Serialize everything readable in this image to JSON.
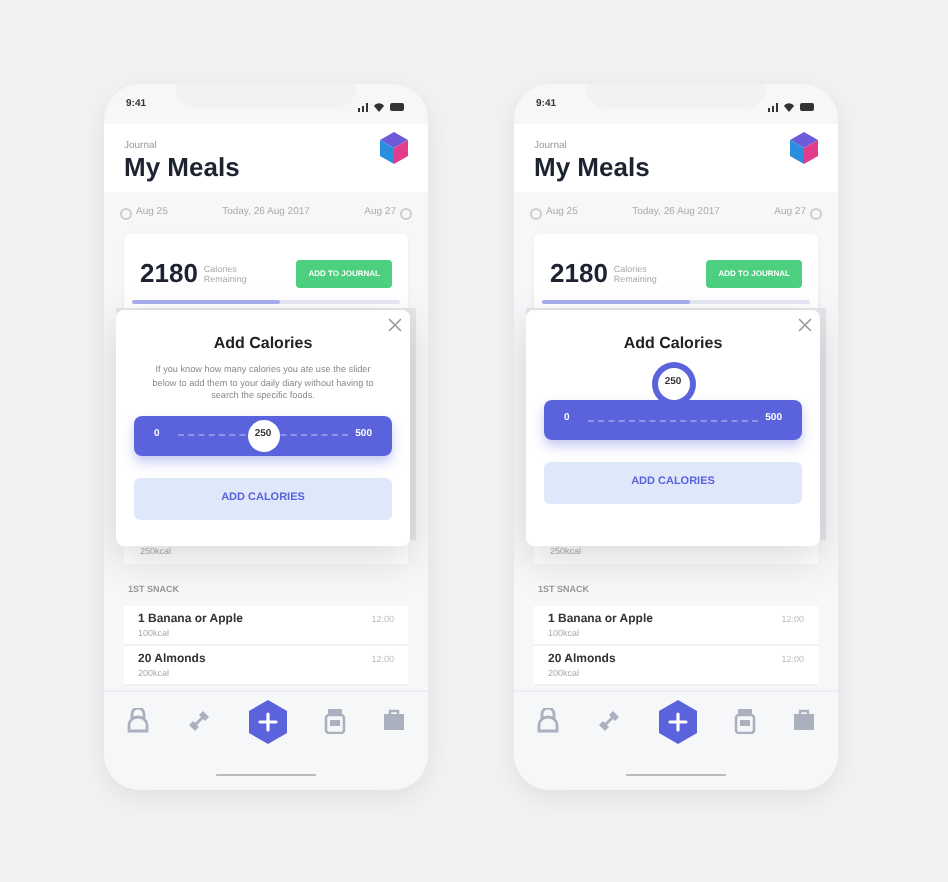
{
  "phones": [
    {
      "status_time": "9:41",
      "overline": "Journal",
      "title": "My Meals",
      "prev_day": "Aug 25",
      "today": "Today, 26 Aug 2017",
      "next_day": "Aug 27",
      "calories": "2180",
      "calories_label": "Calories Remaining",
      "add_journal": "ADD TO JOURNAL",
      "progress": {
        "level": 0.55
      },
      "hidden_kcal": "250kcal",
      "section": "1ST SNACK",
      "items": [
        {
          "name": "1 Banana or Apple",
          "kcal": "100kcal",
          "time": "12:00"
        },
        {
          "name": "20 Almonds",
          "kcal": "200kcal",
          "time": "12:00"
        }
      ],
      "modal": {
        "title": "Add Calories",
        "description": "If you know how many calories you ate use the slider below to add them to your daily diary without having to search the specific foods.",
        "slider": {
          "kind": "inline",
          "min": "0",
          "max": "500",
          "value": "250",
          "level": 0.5
        },
        "button": "ADD CALORIES"
      }
    },
    {
      "status_time": "9:41",
      "overline": "Journal",
      "title": "My Meals",
      "prev_day": "Aug 25",
      "today": "Today, 26 Aug 2017",
      "next_day": "Aug 27",
      "calories": "2180",
      "calories_label": "Calories Remaining",
      "add_journal": "ADD TO JOURNAL",
      "progress": {
        "level": 0.55
      },
      "hidden_kcal": "250kcal",
      "section": "1ST SNACK",
      "items": [
        {
          "name": "1 Banana or Apple",
          "kcal": "100kcal",
          "time": "12:00"
        },
        {
          "name": "20 Almonds",
          "kcal": "200kcal",
          "time": "12:00"
        }
      ],
      "modal": {
        "title": "Add Calories",
        "slider": {
          "kind": "bubble",
          "min": "0",
          "max": "500",
          "value": "250",
          "level": 0.5
        },
        "button": "ADD CALORIES"
      }
    }
  ]
}
